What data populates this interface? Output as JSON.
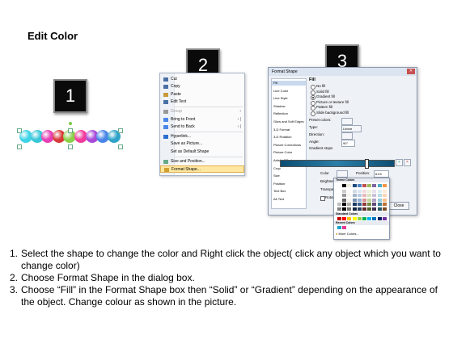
{
  "title": "Edit Color",
  "steps": [
    {
      "num": "1",
      "label": "1"
    },
    {
      "num": "2",
      "label": "2"
    },
    {
      "num": "3",
      "label": "3"
    }
  ],
  "beads": [
    "#3fd3e6",
    "#38c6d8",
    "#e63fb5",
    "#d83a3a",
    "#8bd04a",
    "#f23b9a",
    "#a84ad8",
    "#4a86e8",
    "#2fa3c9"
  ],
  "context_menu": {
    "items": [
      {
        "label": "Cut",
        "icon": "scissors-icon",
        "disabled": false
      },
      {
        "label": "Copy",
        "icon": "copy-icon",
        "disabled": false
      },
      {
        "label": "Paste",
        "icon": "paste-icon",
        "disabled": false
      },
      {
        "label": "Edit Text",
        "icon": "edit-text-icon",
        "disabled": false
      },
      {
        "label": "Group",
        "icon": "group-icon",
        "disabled": true,
        "arrow": "›"
      },
      {
        "label": "Bring to Front",
        "icon": "bring-front-icon",
        "disabled": false,
        "arrow": "› |"
      },
      {
        "label": "Send to Back",
        "icon": "send-back-icon",
        "disabled": false,
        "arrow": "› |"
      },
      {
        "label": "Hyperlink...",
        "icon": "hyperlink-icon",
        "disabled": false
      },
      {
        "label": "Save as Picture...",
        "icon": "",
        "disabled": false
      },
      {
        "label": "Set as Default Shape",
        "icon": "",
        "disabled": false
      },
      {
        "label": "Size and Position...",
        "icon": "size-icon",
        "disabled": false
      },
      {
        "label": "Format Shape...",
        "icon": "format-shape-icon",
        "disabled": false,
        "highlighted": true
      }
    ]
  },
  "dialog": {
    "title": "Format Shape",
    "sidebar": [
      "Fill",
      "Line Color",
      "Line Style",
      "Shadow",
      "Reflection",
      "Glow and Soft Edges",
      "3-D Format",
      "3-D Rotation",
      "Picture Corrections",
      "Picture Color",
      "Artistic Effects",
      "Crop",
      "Size",
      "Position",
      "Text Box",
      "Alt Text"
    ],
    "fill_heading": "Fill",
    "fill_options": [
      {
        "label": "No fill",
        "selected": false
      },
      {
        "label": "Solid fill",
        "selected": false
      },
      {
        "label": "Gradient fill",
        "selected": true
      },
      {
        "label": "Picture or texture fill",
        "selected": false
      },
      {
        "label": "Pattern fill",
        "selected": false
      },
      {
        "label": "Slide background fill",
        "selected": false
      }
    ],
    "preset_colors_label": "Preset colors:",
    "type_label": "Type:",
    "type_value": "Linear",
    "direction_label": "Direction:",
    "angle_label": "Angle:",
    "angle_value": "90°",
    "gradient_stops_label": "Gradient stops",
    "color_label": "Color",
    "position_label": "Position:",
    "position_value": "61%",
    "brightness_label": "Brightness:",
    "transparency_label": "Transparency:",
    "rotate_label": "Rotate with shape",
    "close_label": "Close"
  },
  "color_popup": {
    "theme_label": "Theme Colors",
    "standard_label": "Standard Colors",
    "recent_label": "Recent Colors",
    "more_label": "More Colors...",
    "theme_top": [
      "#ffffff",
      "#000000",
      "#eeece1",
      "#1f497d",
      "#4f81bd",
      "#c0504d",
      "#9bbb59",
      "#8064a2",
      "#4bacc6",
      "#f79646"
    ],
    "standard": [
      "#c00000",
      "#ff0000",
      "#ffc000",
      "#ffff00",
      "#92d050",
      "#00b050",
      "#00b0f0",
      "#0070c0",
      "#002060",
      "#7030a0"
    ],
    "recent": [
      "#1aa3c9",
      "#e6398e"
    ]
  },
  "instructions": [
    {
      "num": "1.",
      "text": "Select the shape to change the color and Right click the object( click any object which you want to change color)"
    },
    {
      "num": "2.",
      "text": "Choose Format Shape in the dialog box."
    },
    {
      "num": "3.",
      "text": "Choose “Fill” in the Format Shape box then “Solid” or “Gradient” depending on the appearance of the object. Change colour as shown in the picture."
    }
  ]
}
